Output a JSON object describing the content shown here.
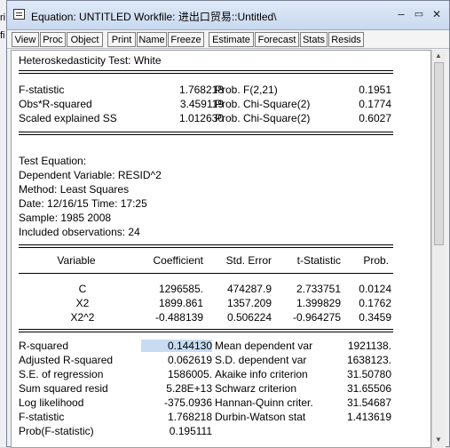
{
  "window": {
    "title": "Equation: UNTITLED   Workfile: 进出口贸易::Untitled\\",
    "side_label_1": "ri",
    "side_label_2": "fi",
    "minimize": "–",
    "restore": "▭",
    "close": "✕"
  },
  "toolbar": [
    "View",
    "Proc",
    "Object",
    "Print",
    "Name",
    "Freeze",
    "Estimate",
    "Forecast",
    "Stats",
    "Resids"
  ],
  "test_title": "Heteroskedasticity Test: White",
  "summary": [
    {
      "label": "F-statistic",
      "value": "1.768218",
      "prob_label": "Prob. F(2,21)",
      "prob": "0.1951"
    },
    {
      "label": "Obs*R-squared",
      "value": "3.459119",
      "prob_label": "Prob. Chi-Square(2)",
      "prob": "0.1774"
    },
    {
      "label": "Scaled explained SS",
      "value": "1.012630",
      "prob_label": "Prob. Chi-Square(2)",
      "prob": "0.6027"
    }
  ],
  "equation_info": [
    "Test Equation:",
    "Dependent Variable: RESID^2",
    "Method: Least Squares",
    "Date: 12/16/15   Time: 17:25",
    "Sample: 1985 2008",
    "Included observations: 24"
  ],
  "coef_headers": [
    "Variable",
    "Coefficient",
    "Std. Error",
    "t-Statistic",
    "Prob."
  ],
  "coef_rows": [
    [
      "C",
      "1296585.",
      "474287.9",
      "2.733751",
      "0.0124"
    ],
    [
      "X2",
      "1899.861",
      "1357.209",
      "1.399829",
      "0.1762"
    ],
    [
      "X2^2",
      "-0.488139",
      "0.506224",
      "-0.964275",
      "0.3459"
    ]
  ],
  "stats_left": [
    [
      "R-squared",
      "0.144130"
    ],
    [
      "Adjusted R-squared",
      "0.062619"
    ],
    [
      "S.E. of regression",
      "1586005."
    ],
    [
      "Sum squared resid",
      "5.28E+13"
    ],
    [
      "Log likelihood",
      "-375.0936"
    ],
    [
      "F-statistic",
      "1.768218"
    ],
    [
      "Prob(F-statistic)",
      "0.195111"
    ]
  ],
  "stats_right": [
    [
      "Mean dependent var",
      "1921138."
    ],
    [
      "S.D. dependent var",
      "1638123."
    ],
    [
      "Akaike info criterion",
      "31.50780"
    ],
    [
      "Schwarz criterion",
      "31.65506"
    ],
    [
      "Hannan-Quinn criter.",
      "31.54687"
    ],
    [
      "Durbin-Watson stat",
      "1.413619"
    ]
  ]
}
